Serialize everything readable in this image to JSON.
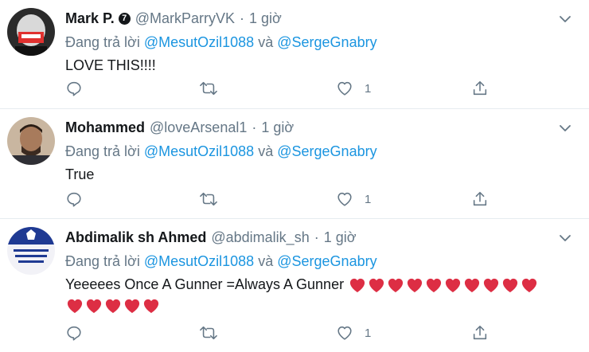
{
  "reply_prefix": "Đang trả lời",
  "reply_joiner": "và",
  "mentions": [
    "@MesutOzil1088",
    "@SergeGnabry"
  ],
  "tweets": [
    {
      "name": "Mark P.",
      "verified_glyph": "7",
      "handle": "@MarkParryVK",
      "sep": "·",
      "time": "1 giờ",
      "text": "LOVE THIS!!!!",
      "like_count": "1"
    },
    {
      "name": "Mohammed",
      "handle": "@loveArsenal1",
      "sep": "·",
      "time": "1 giờ",
      "text": "True",
      "like_count": "1"
    },
    {
      "name": "Abdimalik sh Ahmed",
      "handle": "@abdimalik_sh",
      "sep": "·",
      "time": "1 giờ",
      "text": "Yeeeees Once A Gunner =Always A Gunner",
      "hearts_line1": 10,
      "hearts_line2": 5,
      "like_count": "1"
    }
  ],
  "icons": {
    "reply": "reply-icon",
    "retweet": "retweet-icon",
    "like": "heart-icon",
    "share": "share-icon",
    "caret": "chevron-down-icon"
  },
  "colors": {
    "link": "#1b95e0",
    "muted": "#657786",
    "heart_emoji": "#dd2e44"
  }
}
